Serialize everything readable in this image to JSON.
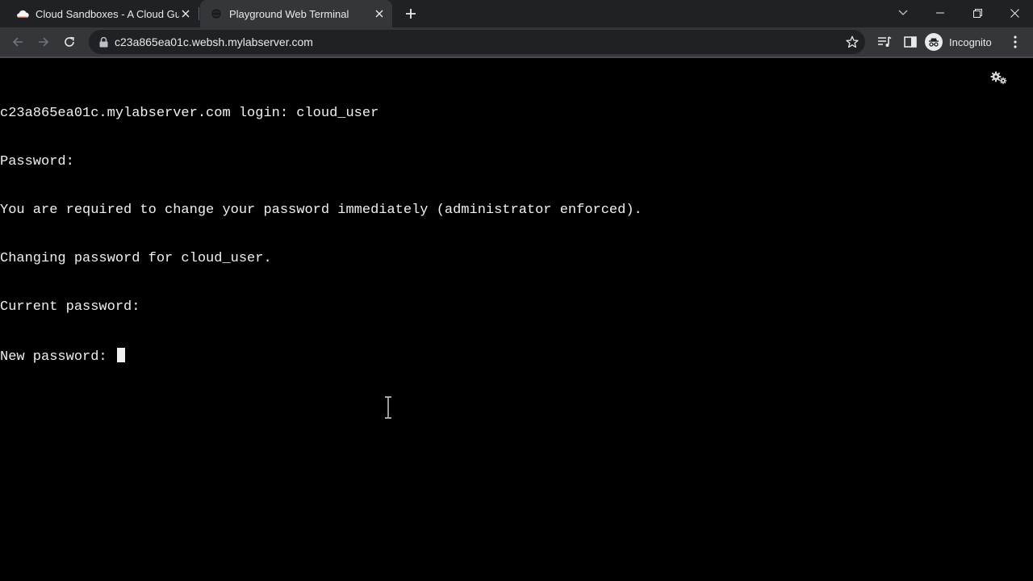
{
  "browser": {
    "tabs": [
      {
        "title": "Cloud Sandboxes - A Cloud Guru",
        "icon": "cloud-icon",
        "active": false
      },
      {
        "title": "Playground Web Terminal",
        "icon": "globe-icon",
        "active": true
      }
    ],
    "url": "c23a865ea01c.websh.mylabserver.com",
    "profile_label": "Incognito"
  },
  "terminal": {
    "lines": [
      "c23a865ea01c.mylabserver.com login: cloud_user",
      "Password:",
      "You are required to change your password immediately (administrator enforced).",
      "Changing password for cloud_user.",
      "Current password:",
      "New password: "
    ],
    "foreground": "#f0f0f0",
    "background": "#000000"
  },
  "colors": {
    "tabstrip_bg": "#202124",
    "toolbar_bg": "#35363a",
    "text": "#e8eaed",
    "cloud_icon_fill": "#f5f5f5"
  }
}
